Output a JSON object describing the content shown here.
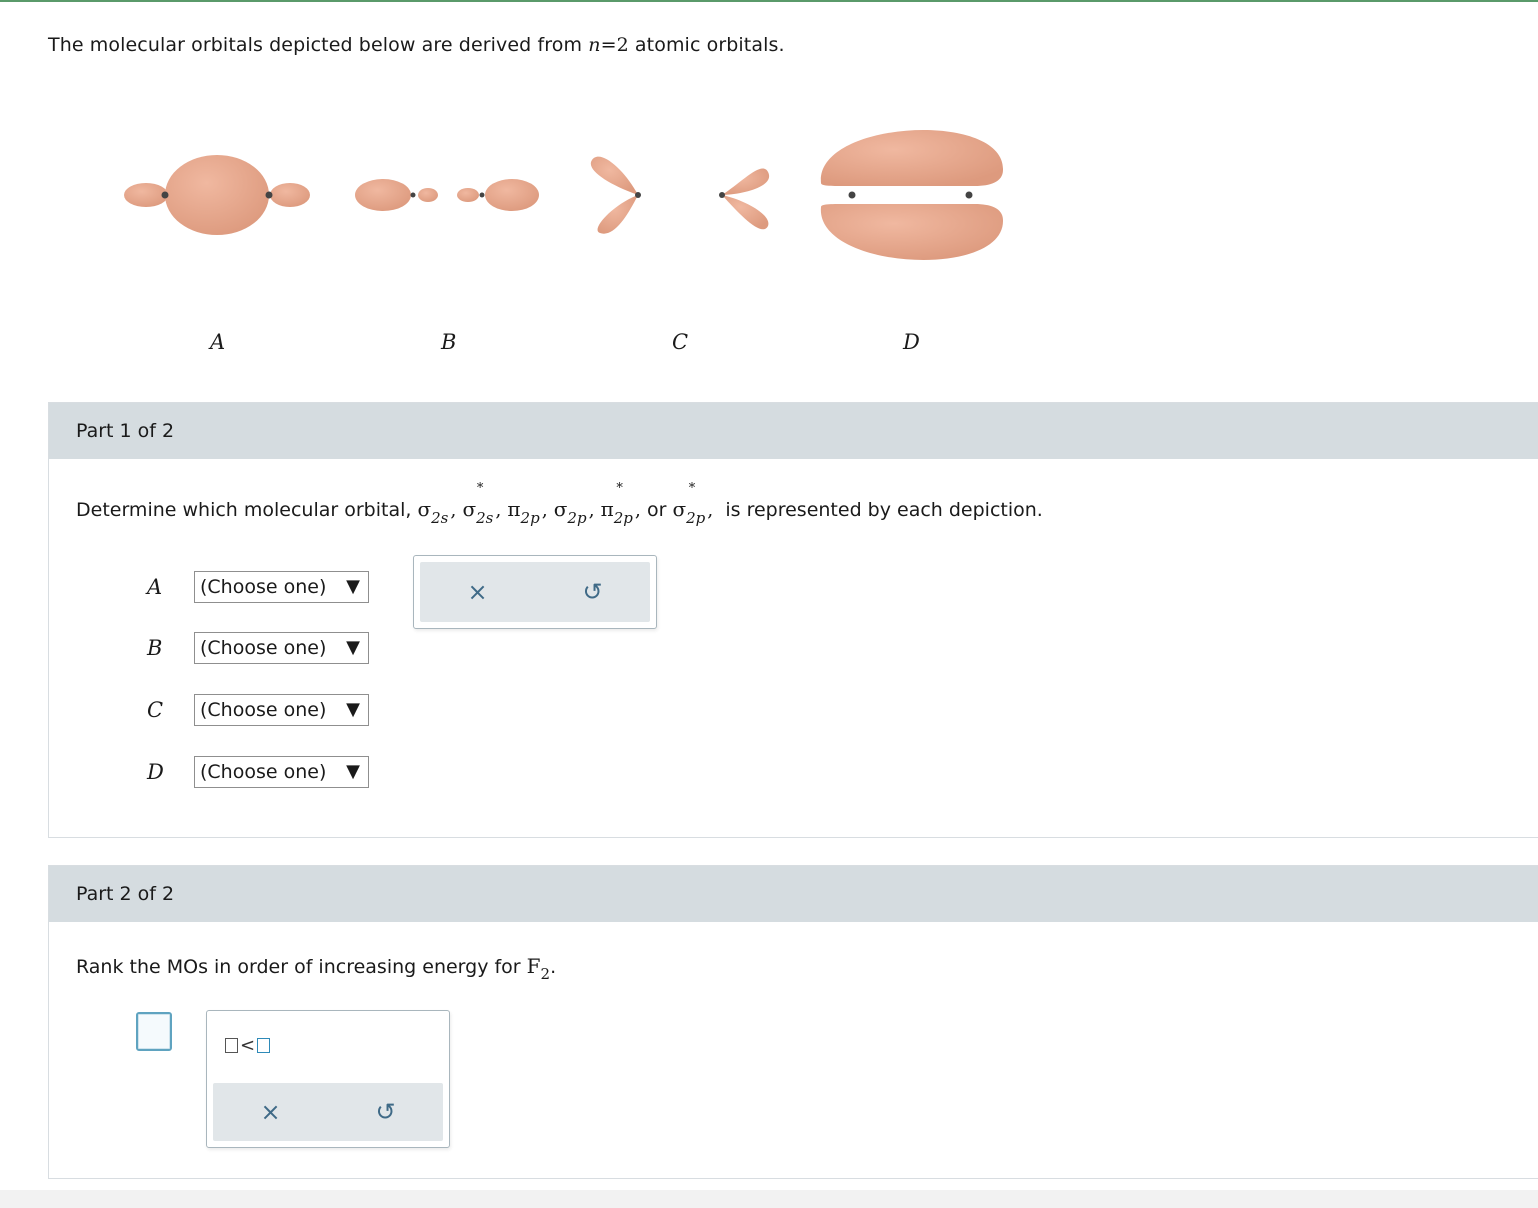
{
  "intro": {
    "prefix": "The molecular orbitals depicted below are derived from ",
    "var": "n",
    "eq": "=2",
    "suffix": " atomic orbitals."
  },
  "orbital_labels": [
    "A",
    "B",
    "C",
    "D"
  ],
  "colors": {
    "lobe": "#e8a88c",
    "panel_header": "#d5dce0",
    "tool_icon": "#3f6a87",
    "accent": "#5fa3c0"
  },
  "part1": {
    "header": "Part 1 of 2",
    "question_prefix": "Determine which molecular orbital, ",
    "mos": [
      {
        "sym": "σ",
        "sub": "2s",
        "star": ""
      },
      {
        "sym": "σ",
        "sub": "2s",
        "star": "*"
      },
      {
        "sym": "π",
        "sub": "2p",
        "star": ""
      },
      {
        "sym": "σ",
        "sub": "2p",
        "star": ""
      },
      {
        "sym": "π",
        "sub": "2p",
        "star": "*"
      },
      {
        "sym": "σ",
        "sub": "2p",
        "star": "*"
      }
    ],
    "or_text": "or",
    "question_suffix": " is represented by each depiction.",
    "rows": [
      {
        "label": "A",
        "value": "(Choose one)"
      },
      {
        "label": "B",
        "value": "(Choose one)"
      },
      {
        "label": "C",
        "value": "(Choose one)"
      },
      {
        "label": "D",
        "value": "(Choose one)"
      }
    ],
    "dropdown_arrow": "▼",
    "tools": {
      "clear": "×",
      "undo": "↺"
    }
  },
  "part2": {
    "header": "Part 2 of 2",
    "question": "Rank the MOs in order of increasing energy for ",
    "molecule": "F",
    "molecule_sub": "2",
    "period": ".",
    "template_sep": "<",
    "tools": {
      "clear": "×",
      "undo": "↺"
    }
  }
}
